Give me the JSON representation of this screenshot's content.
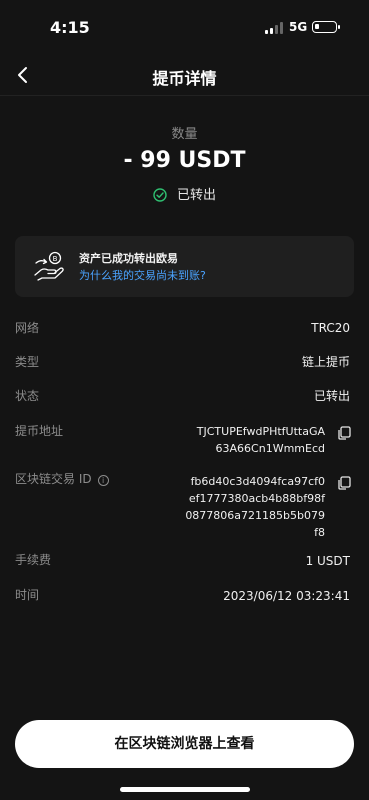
{
  "status_bar": {
    "time": "4:15",
    "network": "5G"
  },
  "header": {
    "title": "提币详情"
  },
  "summary": {
    "quantity_label": "数量",
    "amount": "- 99 USDT",
    "status": "已转出"
  },
  "notice": {
    "title": "资产已成功转出欧易",
    "link": "为什么我的交易尚未到账?"
  },
  "details": {
    "network": {
      "label": "网络",
      "value": "TRC20"
    },
    "type": {
      "label": "类型",
      "value": "链上提币"
    },
    "status": {
      "label": "状态",
      "value": "已转出"
    },
    "address": {
      "label": "提币地址",
      "line1": "TJCTUPEfwdPHtfUttaGA",
      "line2": "63A66Cn1WmmEcd"
    },
    "txid": {
      "label": "区块链交易 ID",
      "line1": "fb6d40c3d4094fca97cf0",
      "line2": "ef1777380acb4b88bf98f",
      "line3": "0877806a721185b5b079",
      "line4": "f8"
    },
    "fee": {
      "label": "手续费",
      "value": "1 USDT"
    },
    "time": {
      "label": "时间",
      "value": "2023/06/12 03:23:41"
    }
  },
  "action": {
    "label": "在区块链浏览器上查看"
  },
  "colors": {
    "background": "#141414",
    "card": "#1f1f1f",
    "link": "#4aa3ff",
    "success": "#2fbf71"
  }
}
